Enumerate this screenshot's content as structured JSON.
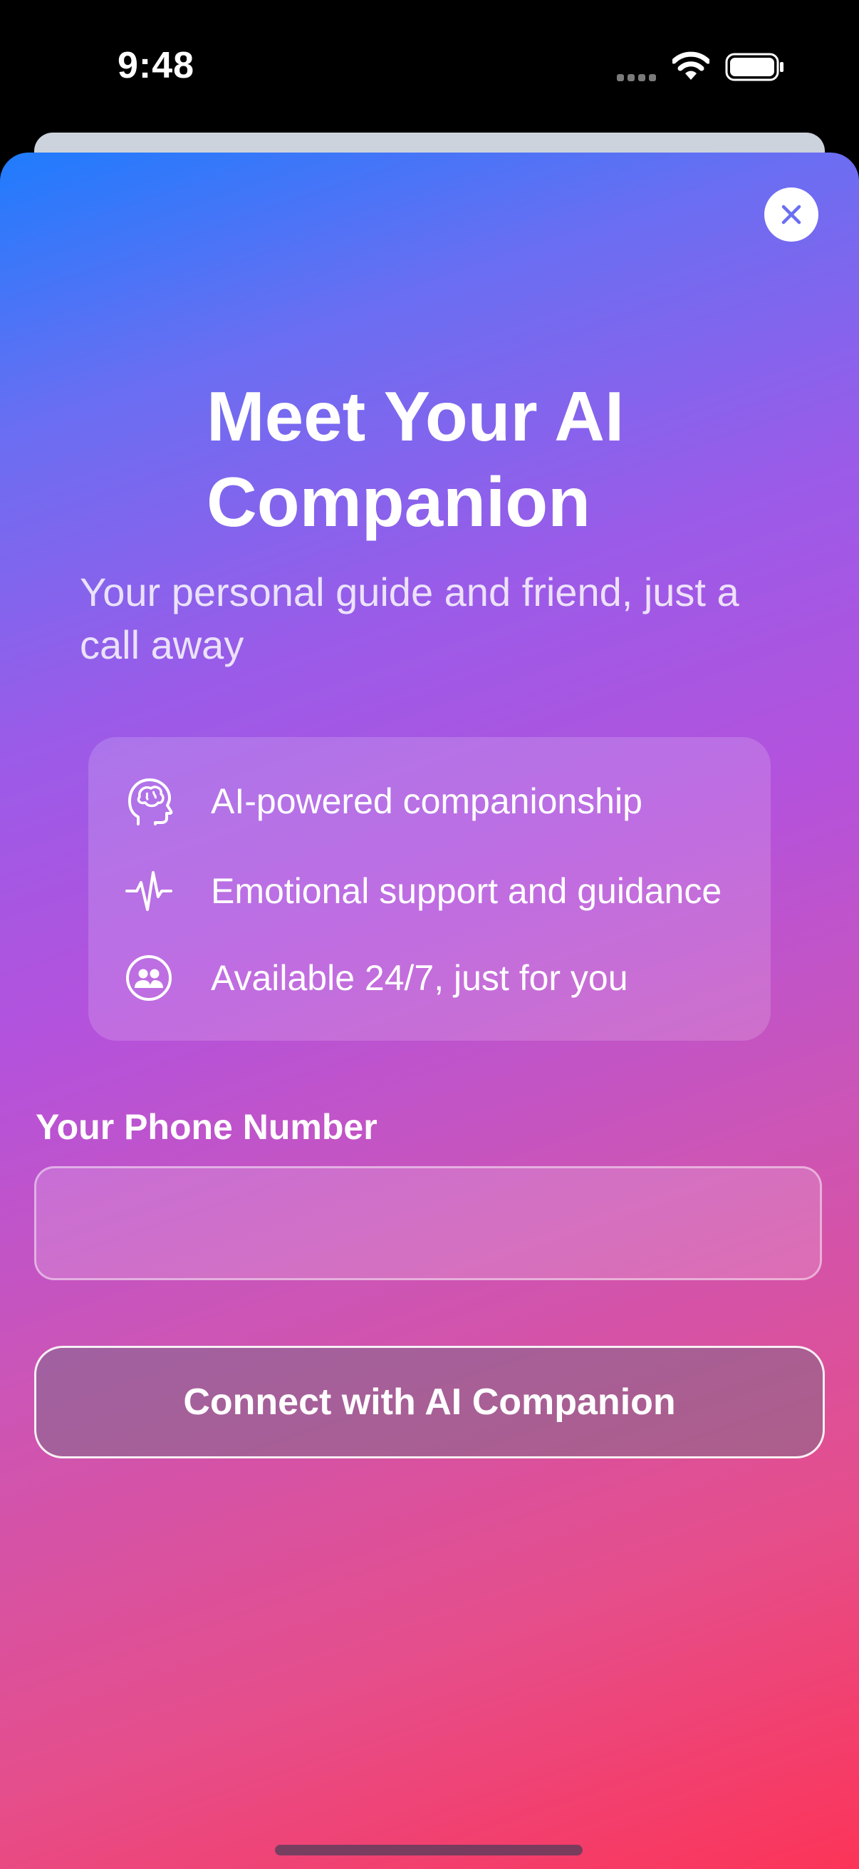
{
  "status_bar": {
    "time": "9:48"
  },
  "sheet": {
    "title": "Meet Your AI Companion",
    "subtitle": "Your personal guide and friend, just a call away",
    "features": [
      {
        "icon": "brain-head-icon",
        "label": "AI-powered companionship"
      },
      {
        "icon": "waveform-pulse-icon",
        "label": "Emotional support and guidance"
      },
      {
        "icon": "people-circle-icon",
        "label": "Available 24/7, just for you"
      }
    ],
    "phone": {
      "label": "Your Phone Number",
      "value": "",
      "placeholder": ""
    },
    "connect_button_label": "Connect with AI Companion"
  },
  "colors": {
    "gradient_start": "#1f7cfd",
    "gradient_mid": "#b452dc",
    "gradient_end": "#fc3458",
    "close_icon": "#6a6ef2"
  }
}
